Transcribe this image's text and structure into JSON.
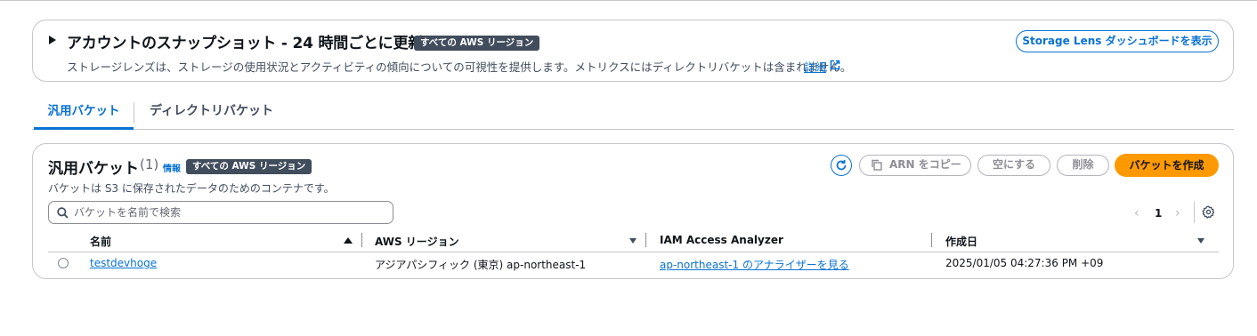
{
  "snapshot": {
    "title": "アカウントのスナップショット - 24 時間ごとに更新",
    "badge": "すべての AWS リージョン",
    "description": "ストレージレンズは、ストレージの使用状況とアクティビティの傾向についての可視性を提供します。メトリクスにはディレクトリバケットは含まれません。",
    "link_label": "詳細",
    "dashboard_button": "Storage Lens ダッシュボードを表示"
  },
  "tabs": [
    {
      "label": "汎用バケット",
      "active": true
    },
    {
      "label": "ディレクトリバケット",
      "active": false
    }
  ],
  "panel": {
    "title": "汎用バケット",
    "count": "(1)",
    "info_label": "情報",
    "badge": "すべての AWS リージョン",
    "description": "バケットは S3 に保存されたデータのためのコンテナです。",
    "copy_arn_label": "ARN をコピー",
    "empty_label": "空にする",
    "delete_label": "削除",
    "create_label": "バケットを作成",
    "search_placeholder": "バケットを名前で検索",
    "page_number": "1"
  },
  "table": {
    "columns": [
      "名前",
      "AWS リージョン",
      "IAM Access Analyzer",
      "作成日"
    ],
    "rows": [
      {
        "name": "testdevhoge",
        "region": "アジアパシフィック (東京) ap-northeast-1",
        "iam": "ap-northeast-1 のアナライザーを見る",
        "created": "2025/01/05 04:27:36 PM +09"
      }
    ]
  },
  "colors": {
    "accent": "#0972d3",
    "primary_button": "#ff9900",
    "badge_bg": "#414d5c",
    "border": "#c6c6cd"
  }
}
